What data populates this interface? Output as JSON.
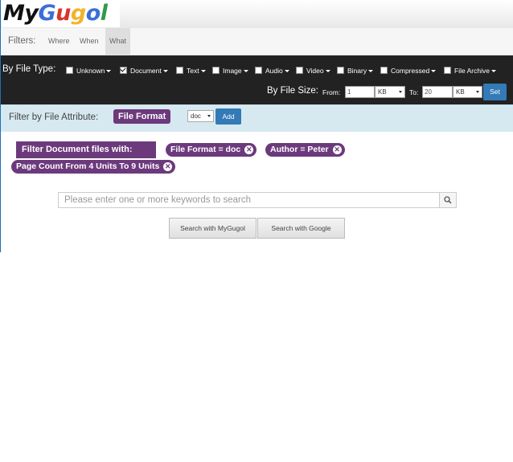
{
  "logo": {
    "parts": [
      "My",
      "G",
      "u",
      "g",
      "o",
      "l"
    ]
  },
  "filter_tabs": {
    "label": "Filters:",
    "tabs": [
      "Where",
      "When",
      "What"
    ],
    "active": "What"
  },
  "file_type": {
    "label": "By File Type:",
    "types": [
      {
        "label": "Unknown",
        "checked": false
      },
      {
        "label": "Document",
        "checked": true
      },
      {
        "label": "Text",
        "checked": false
      },
      {
        "label": "Image",
        "checked": false
      },
      {
        "label": "Audio",
        "checked": false
      },
      {
        "label": "Video",
        "checked": false
      },
      {
        "label": "Binary",
        "checked": false
      },
      {
        "label": "Compressed",
        "checked": false
      },
      {
        "label": "File Archive",
        "checked": false
      }
    ]
  },
  "file_size": {
    "label": "By File Size:",
    "from_label": "From:",
    "from_value": "1",
    "from_unit": "KB",
    "to_label": "To:",
    "to_value": "20",
    "to_unit": "KB",
    "set_label": "Set"
  },
  "attribute": {
    "label": "Filter by File Attribute:",
    "selected": "File Format",
    "value": "doc",
    "add_label": "Add"
  },
  "active_filters": {
    "heading": "Filter Document files with:",
    "chips": [
      "File Format = doc",
      "Author = Peter",
      "Page Count From 4 Units To 9 Units"
    ]
  },
  "search": {
    "placeholder": "Please enter one or more keywords to search",
    "mygugol_label": "Search with MyGugol",
    "google_label": "Search with Google"
  },
  "colors": {
    "dark_bar": "#222222",
    "attr_bar": "#d7e9f0",
    "accent_purple": "#6c3a7c",
    "button_blue": "#337ab7"
  }
}
